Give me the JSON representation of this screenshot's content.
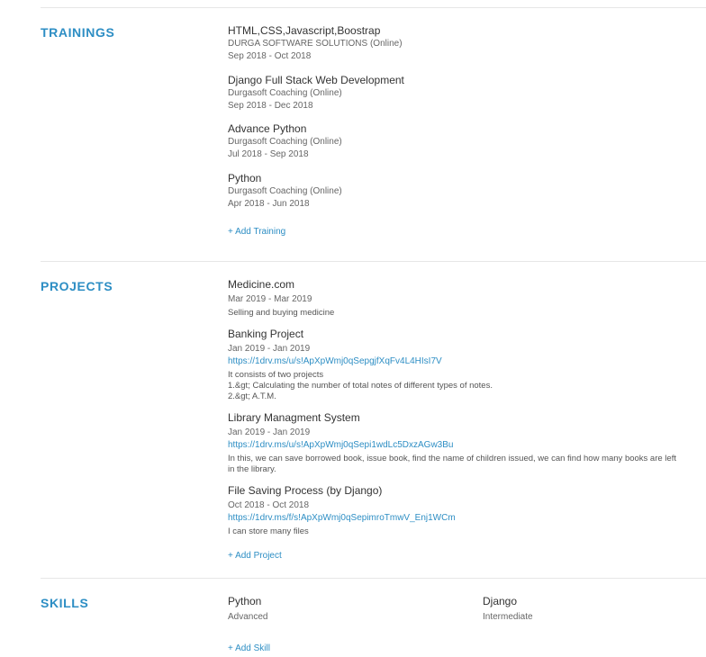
{
  "trainings": {
    "title": "TRAININGS",
    "items": [
      {
        "name": "HTML,CSS,Javascript,Boostrap",
        "org": "DURGA SOFTWARE SOLUTIONS (Online)",
        "dates": "Sep 2018 - Oct 2018"
      },
      {
        "name": "Django Full Stack Web Development",
        "org": "Durgasoft Coaching (Online)",
        "dates": "Sep 2018 - Dec 2018"
      },
      {
        "name": "Advance Python",
        "org": "Durgasoft Coaching (Online)",
        "dates": "Jul 2018 - Sep 2018"
      },
      {
        "name": "Python",
        "org": "Durgasoft Coaching (Online)",
        "dates": "Apr 2018 - Jun 2018"
      }
    ],
    "add_label": "+ Add Training"
  },
  "projects": {
    "title": "PROJECTS",
    "items": [
      {
        "name": "Medicine.com",
        "dates": "Mar 2019 - Mar 2019",
        "link": "",
        "desc": [
          "Selling and buying medicine"
        ]
      },
      {
        "name": "Banking Project",
        "dates": "Jan 2019 - Jan 2019",
        "link": "https://1drv.ms/u/s!ApXpWmj0qSepgjfXqFv4L4HIsI7V",
        "desc": [
          "It consists of two projects",
          "1.&gt; Calculating the number of total notes of different types of notes.",
          "2.&gt; A.T.M."
        ]
      },
      {
        "name": "Library Managment System",
        "dates": "Jan 2019 - Jan 2019",
        "link": "https://1drv.ms/u/s!ApXpWmj0qSepi1wdLc5DxzAGw3Bu",
        "desc": [
          "In this, we can save borrowed book, issue book, find the name of children issued, we can find how many books are left",
          "in the library."
        ]
      },
      {
        "name": "File Saving Process (by Django)",
        "dates": "Oct 2018 - Oct 2018",
        "link": "https://1drv.ms/f/s!ApXpWmj0qSepimroTmwV_Enj1WCm",
        "desc": [
          "I can store many files"
        ]
      }
    ],
    "add_label": "+ Add Project"
  },
  "skills": {
    "title": "SKILLS",
    "items": [
      {
        "name": "Python",
        "level": "Advanced"
      },
      {
        "name": "Django",
        "level": "Intermediate"
      }
    ],
    "add_label": "+ Add Skill"
  }
}
